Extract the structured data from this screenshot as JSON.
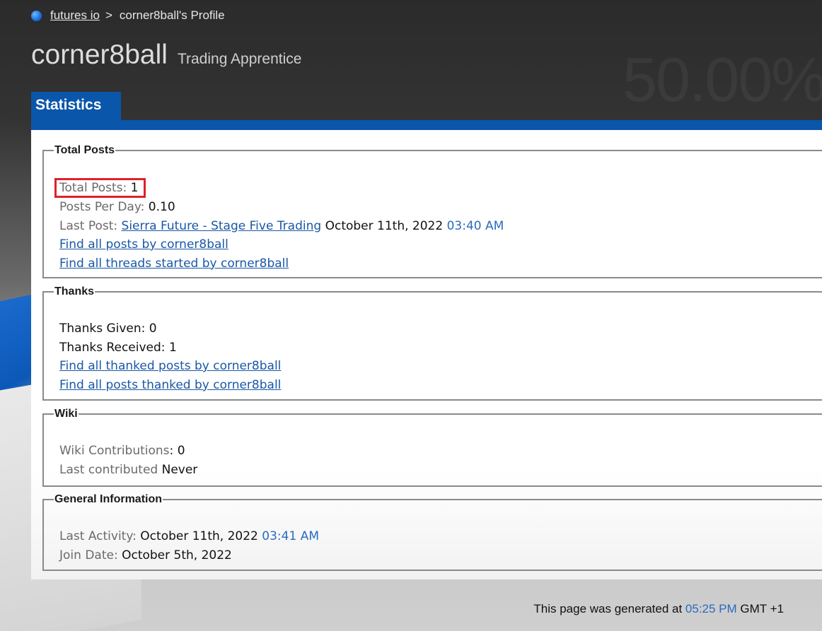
{
  "breadcrumb": {
    "site": "futures io",
    "separator": ">",
    "current": "corner8ball's Profile"
  },
  "profile": {
    "username": "corner8ball",
    "user_title": "Trading Apprentice"
  },
  "tabs": {
    "active": "Statistics"
  },
  "total_posts": {
    "legend": "Total Posts",
    "total_posts_label": "Total Posts:",
    "total_posts_value": "1",
    "posts_per_day_label": "Posts Per Day:",
    "posts_per_day_value": "0.10",
    "last_post_label": "Last Post:",
    "last_post_thread": "Sierra Future - Stage Five Trading",
    "last_post_date": "October 11th, 2022",
    "last_post_time": "03:40 AM",
    "find_posts_link": "Find all posts by corner8ball",
    "find_threads_link": "Find all threads started by corner8ball"
  },
  "thanks": {
    "legend": "Thanks",
    "given_label": "Thanks Given:",
    "given_value": "0",
    "received_label": "Thanks Received:",
    "received_value": "1",
    "find_thanked_link": "Find all thanked posts by corner8ball",
    "find_posts_thanked_link": "Find all posts thanked by corner8ball"
  },
  "wiki": {
    "legend": "Wiki",
    "contributions_label": "Wiki Contributions",
    "contributions_value": "0",
    "last_contributed_label": "Last contributed",
    "last_contributed_value": "Never"
  },
  "general": {
    "legend": "General Information",
    "last_activity_label": "Last Activity:",
    "last_activity_date": "October 11th, 2022",
    "last_activity_time": "03:41 AM",
    "join_date_label": "Join Date:",
    "join_date_value": "October 5th, 2022"
  },
  "footer": {
    "prefix": "This page was generated at",
    "time": "05:25 PM",
    "suffix": "GMT +1"
  },
  "colors": {
    "accent_blue": "#0a56ab",
    "link_blue": "#1a57a6",
    "highlight_red": "#e0202a"
  }
}
